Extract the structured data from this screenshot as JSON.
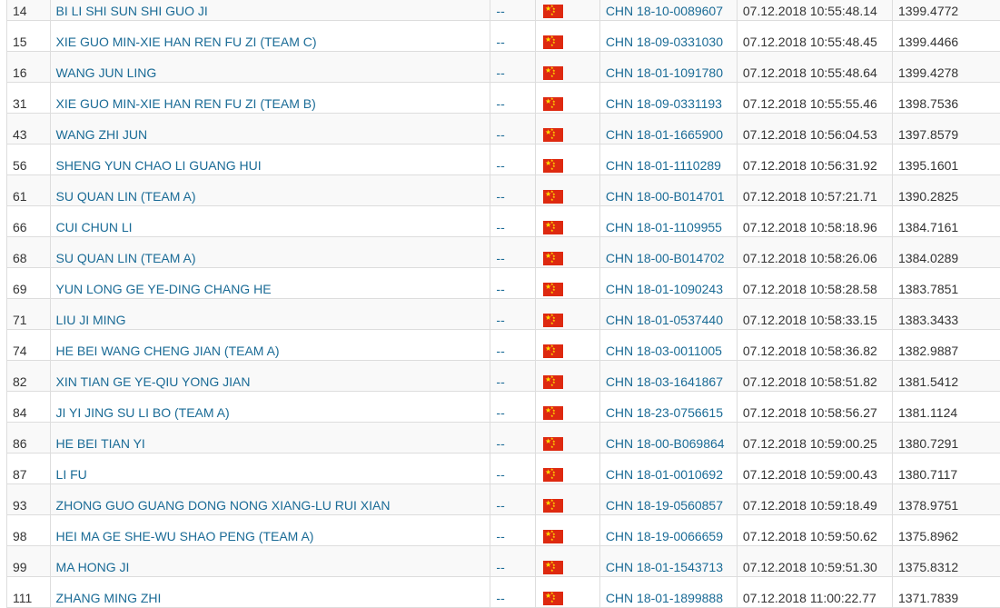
{
  "colors": {
    "link": "#1a6b96",
    "flag_red": "#de2910",
    "flag_yellow": "#ffde00",
    "row_alt": "#f9f9f9",
    "border": "#dddddd"
  },
  "flag_icon": "china-flag-icon",
  "rows": [
    {
      "rank": "14",
      "name": "BI LI SHI SUN SHI GUO JI",
      "dash": "--",
      "ring": "CHN 18-10-0089607",
      "time": "07.12.2018 10:55:48.14",
      "score": "1399.4772"
    },
    {
      "rank": "15",
      "name": "XIE GUO MIN-XIE HAN REN FU ZI (TEAM C)",
      "dash": "--",
      "ring": "CHN 18-09-0331030",
      "time": "07.12.2018 10:55:48.45",
      "score": "1399.4466"
    },
    {
      "rank": "16",
      "name": "WANG JUN LING",
      "dash": "--",
      "ring": "CHN 18-01-1091780",
      "time": "07.12.2018 10:55:48.64",
      "score": "1399.4278"
    },
    {
      "rank": "31",
      "name": "XIE GUO MIN-XIE HAN REN FU ZI (TEAM B)",
      "dash": "--",
      "ring": "CHN 18-09-0331193",
      "time": "07.12.2018 10:55:55.46",
      "score": "1398.7536"
    },
    {
      "rank": "43",
      "name": "WANG ZHI JUN",
      "dash": "--",
      "ring": "CHN 18-01-1665900",
      "time": "07.12.2018 10:56:04.53",
      "score": "1397.8579"
    },
    {
      "rank": "56",
      "name": "SHENG YUN CHAO LI GUANG HUI",
      "dash": "--",
      "ring": "CHN 18-01-1110289",
      "time": "07.12.2018 10:56:31.92",
      "score": "1395.1601"
    },
    {
      "rank": "61",
      "name": "SU QUAN LIN (TEAM A)",
      "dash": "--",
      "ring": "CHN 18-00-B014701",
      "time": "07.12.2018 10:57:21.71",
      "score": "1390.2825"
    },
    {
      "rank": "66",
      "name": "CUI CHUN LI",
      "dash": "--",
      "ring": "CHN 18-01-1109955",
      "time": "07.12.2018 10:58:18.96",
      "score": "1384.7161"
    },
    {
      "rank": "68",
      "name": "SU QUAN LIN (TEAM A)",
      "dash": "--",
      "ring": "CHN 18-00-B014702",
      "time": "07.12.2018 10:58:26.06",
      "score": "1384.0289"
    },
    {
      "rank": "69",
      "name": "YUN LONG GE YE-DING CHANG HE",
      "dash": "--",
      "ring": "CHN 18-01-1090243",
      "time": "07.12.2018 10:58:28.58",
      "score": "1383.7851"
    },
    {
      "rank": "71",
      "name": "LIU JI MING",
      "dash": "--",
      "ring": "CHN 18-01-0537440",
      "time": "07.12.2018 10:58:33.15",
      "score": "1383.3433"
    },
    {
      "rank": "74",
      "name": "HE BEI WANG CHENG JIAN (TEAM A)",
      "dash": "--",
      "ring": "CHN 18-03-0011005",
      "time": "07.12.2018 10:58:36.82",
      "score": "1382.9887"
    },
    {
      "rank": "82",
      "name": "XIN TIAN GE YE-QIU YONG JIAN",
      "dash": "--",
      "ring": "CHN 18-03-1641867",
      "time": "07.12.2018 10:58:51.82",
      "score": "1381.5412"
    },
    {
      "rank": "84",
      "name": "JI YI JING SU LI BO (TEAM A)",
      "dash": "--",
      "ring": "CHN 18-23-0756615",
      "time": "07.12.2018 10:58:56.27",
      "score": "1381.1124"
    },
    {
      "rank": "86",
      "name": "HE BEI TIAN YI",
      "dash": "--",
      "ring": "CHN 18-00-B069864",
      "time": "07.12.2018 10:59:00.25",
      "score": "1380.7291"
    },
    {
      "rank": "87",
      "name": "LI FU",
      "dash": "--",
      "ring": "CHN 18-01-0010692",
      "time": "07.12.2018 10:59:00.43",
      "score": "1380.7117"
    },
    {
      "rank": "93",
      "name": "ZHONG GUO GUANG DONG NONG XIANG-LU RUI XIAN",
      "dash": "--",
      "ring": "CHN 18-19-0560857",
      "time": "07.12.2018 10:59:18.49",
      "score": "1378.9751"
    },
    {
      "rank": "98",
      "name": "HEI MA GE SHE-WU SHAO PENG (TEAM A)",
      "dash": "--",
      "ring": "CHN 18-19-0066659",
      "time": "07.12.2018 10:59:50.62",
      "score": "1375.8962"
    },
    {
      "rank": "99",
      "name": "MA HONG JI",
      "dash": "--",
      "ring": "CHN 18-01-1543713",
      "time": "07.12.2018 10:59:51.30",
      "score": "1375.8312"
    },
    {
      "rank": "111",
      "name": "ZHANG MING ZHI",
      "dash": "--",
      "ring": "CHN 18-01-1899888",
      "time": "07.12.2018 11:00:22.77",
      "score": "1371.7839"
    }
  ]
}
